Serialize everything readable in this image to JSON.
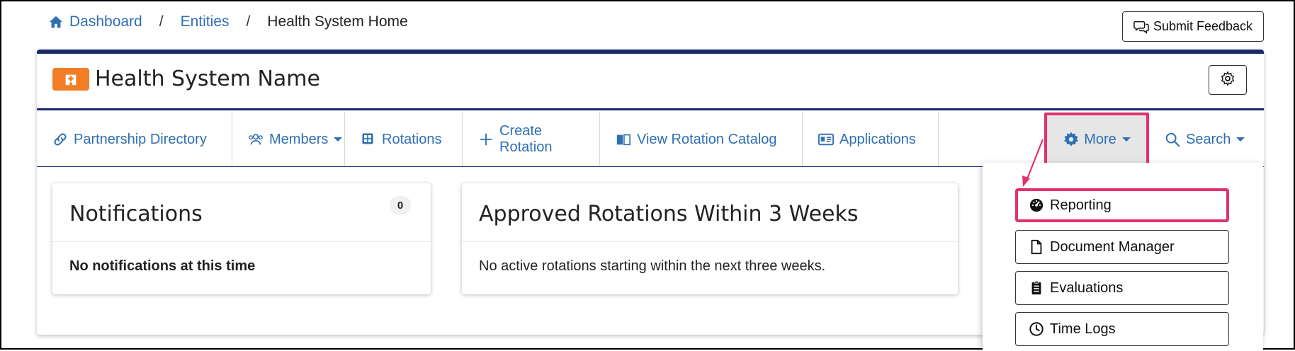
{
  "breadcrumb": {
    "items": [
      "Dashboard",
      "Entities"
    ],
    "separator": "/",
    "current": "Health System Home"
  },
  "feedback": {
    "label": "Submit Feedback"
  },
  "entity": {
    "title": "Health System Name",
    "badge_color": "#f07e26"
  },
  "nav": {
    "items": [
      {
        "label": "Partnership Directory",
        "icon": "link-icon"
      },
      {
        "label": "Members",
        "icon": "users-icon",
        "dropdown": true
      },
      {
        "label": "Rotations",
        "icon": "grid-icon"
      },
      {
        "label": "Create Rotation",
        "icon": "plus-icon"
      },
      {
        "label": "View Rotation Catalog",
        "icon": "book-icon"
      },
      {
        "label": "Applications",
        "icon": "id-card-icon"
      }
    ],
    "more": {
      "label": "More",
      "icon": "gear-icon"
    },
    "search": {
      "label": "Search",
      "icon": "search-icon"
    }
  },
  "panels": {
    "notifications": {
      "title": "Notifications",
      "count": "0",
      "message": "No notifications at this time"
    },
    "approved": {
      "title": "Approved Rotations Within 3 Weeks",
      "message": "No active rotations starting within the next three weeks."
    }
  },
  "more_menu": {
    "items": [
      {
        "label": "Reporting",
        "icon": "dashboard-gauge-icon",
        "highlighted": true
      },
      {
        "label": "Document Manager",
        "icon": "file-icon"
      },
      {
        "label": "Evaluations",
        "icon": "clipboard-icon"
      },
      {
        "label": "Time Logs",
        "icon": "clock-icon"
      }
    ]
  },
  "colors": {
    "link": "#2f6fb3",
    "navy": "#1b2a6b",
    "highlight": "#e0336b",
    "badge": "#f07e26"
  }
}
